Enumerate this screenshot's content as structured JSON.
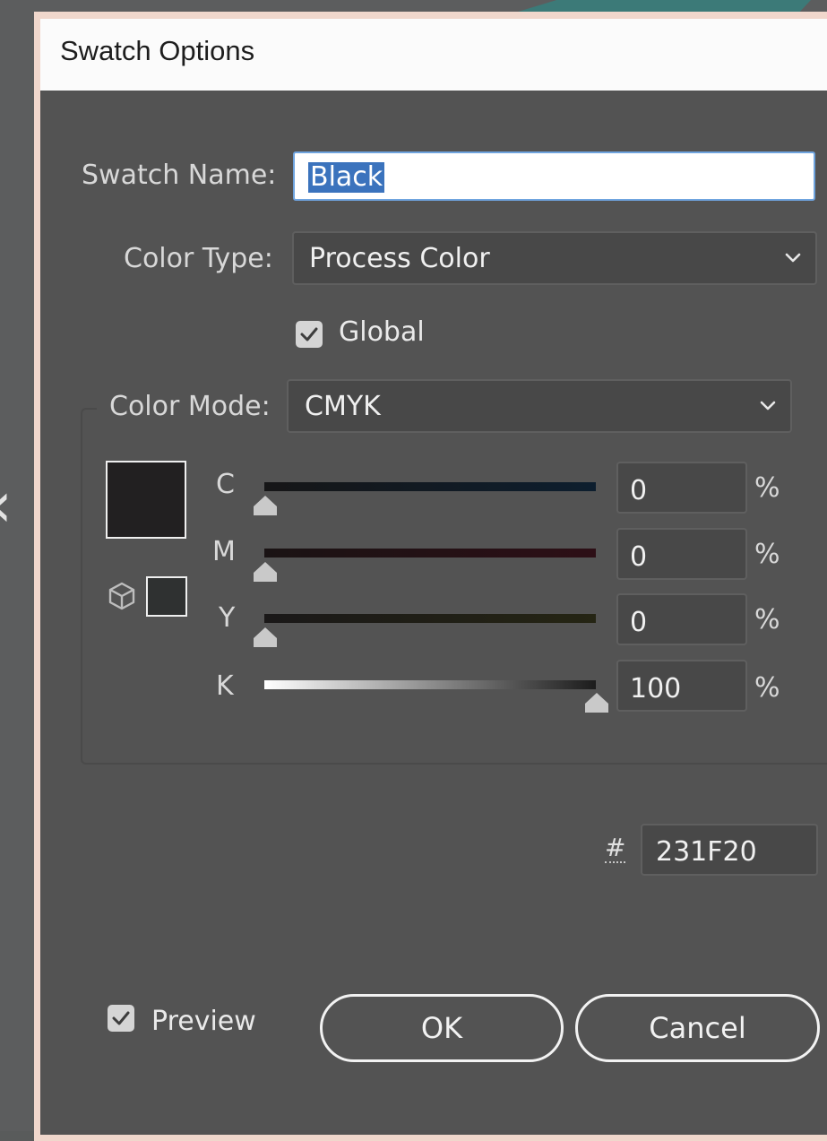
{
  "dialog": {
    "title": "Swatch Options"
  },
  "swatch_name": {
    "label": "Swatch Name:",
    "value": "Black"
  },
  "color_type": {
    "label": "Color Type:",
    "value": "Process Color"
  },
  "global": {
    "label": "Global",
    "checked": true
  },
  "color_mode": {
    "label": "Color Mode:",
    "value": "CMYK"
  },
  "sliders": [
    {
      "channel": "C",
      "value": "0",
      "unit": "%",
      "percent": 0
    },
    {
      "channel": "M",
      "value": "0",
      "unit": "%",
      "percent": 0
    },
    {
      "channel": "Y",
      "value": "0",
      "unit": "%",
      "percent": 0
    },
    {
      "channel": "K",
      "value": "100",
      "unit": "%",
      "percent": 100
    }
  ],
  "hex": {
    "label": "#",
    "value": "231F20"
  },
  "preview": {
    "label": "Preview",
    "checked": true
  },
  "buttons": {
    "ok": "OK",
    "cancel": "Cancel"
  },
  "colors": {
    "swatch": "#231F20",
    "selection": "#3B73BD",
    "dialog_bg": "#535353"
  },
  "icons": [
    "chevron-down-icon",
    "checkmark-icon",
    "cube-icon",
    "slider-thumb-icon"
  ]
}
